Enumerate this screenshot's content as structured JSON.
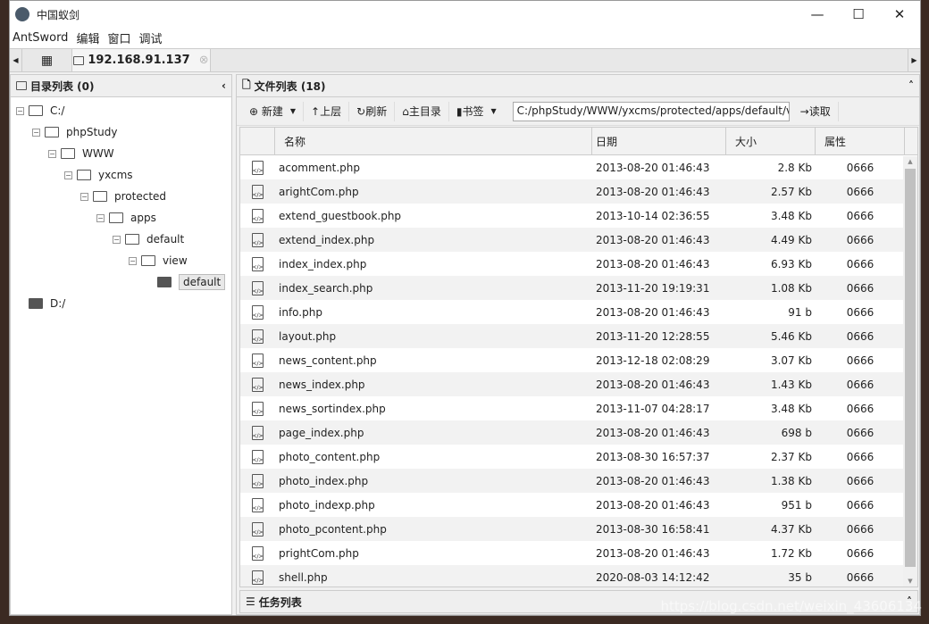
{
  "window": {
    "title": "中国蚁剑",
    "controls": [
      "—",
      "☐",
      "✕"
    ]
  },
  "menu": [
    "AntSword",
    "编辑",
    "窗口",
    "调试"
  ],
  "tabs": {
    "home_icon": "grid-icon",
    "active": "192.168.91.137"
  },
  "dir_panel": {
    "title": "目录列表 (0)",
    "tree": [
      {
        "label": "C:/",
        "depth": 0
      },
      {
        "label": "phpStudy",
        "depth": 1
      },
      {
        "label": "WWW",
        "depth": 2
      },
      {
        "label": "yxcms",
        "depth": 3
      },
      {
        "label": "protected",
        "depth": 4
      },
      {
        "label": "apps",
        "depth": 5
      },
      {
        "label": "default",
        "depth": 6
      },
      {
        "label": "view",
        "depth": 7
      },
      {
        "label": "default",
        "depth": 8,
        "selected": true
      },
      {
        "label": "D:/",
        "depth": 0
      }
    ]
  },
  "file_panel": {
    "title": "文件列表 (18)",
    "toolbar": {
      "new": "新建",
      "up": "上层",
      "refresh": "刷新",
      "home": "主目录",
      "bookmark": "书签",
      "path": "C:/phpStudy/WWW/yxcms/protected/apps/default/view/",
      "read": "读取"
    },
    "columns": [
      "名称",
      "日期",
      "大小",
      "属性"
    ],
    "files": [
      [
        "acomment.php",
        "2013-08-20 01:46:43",
        "2.8 Kb",
        "0666"
      ],
      [
        "arightCom.php",
        "2013-08-20 01:46:43",
        "2.57 Kb",
        "0666"
      ],
      [
        "extend_guestbook.php",
        "2013-10-14 02:36:55",
        "3.48 Kb",
        "0666"
      ],
      [
        "extend_index.php",
        "2013-08-20 01:46:43",
        "4.49 Kb",
        "0666"
      ],
      [
        "index_index.php",
        "2013-08-20 01:46:43",
        "6.93 Kb",
        "0666"
      ],
      [
        "index_search.php",
        "2013-11-20 19:19:31",
        "1.08 Kb",
        "0666"
      ],
      [
        "info.php",
        "2013-08-20 01:46:43",
        "91 b",
        "0666"
      ],
      [
        "layout.php",
        "2013-11-20 12:28:55",
        "5.46 Kb",
        "0666"
      ],
      [
        "news_content.php",
        "2013-12-18 02:08:29",
        "3.07 Kb",
        "0666"
      ],
      [
        "news_index.php",
        "2013-08-20 01:46:43",
        "1.43 Kb",
        "0666"
      ],
      [
        "news_sortindex.php",
        "2013-11-07 04:28:17",
        "3.48 Kb",
        "0666"
      ],
      [
        "page_index.php",
        "2013-08-20 01:46:43",
        "698 b",
        "0666"
      ],
      [
        "photo_content.php",
        "2013-08-30 16:57:37",
        "2.37 Kb",
        "0666"
      ],
      [
        "photo_index.php",
        "2013-08-20 01:46:43",
        "1.38 Kb",
        "0666"
      ],
      [
        "photo_indexp.php",
        "2013-08-20 01:46:43",
        "951 b",
        "0666"
      ],
      [
        "photo_pcontent.php",
        "2013-08-30 16:58:41",
        "4.37 Kb",
        "0666"
      ],
      [
        "prightCom.php",
        "2013-08-20 01:46:43",
        "1.72 Kb",
        "0666"
      ],
      [
        "shell.php",
        "2020-08-03 14:12:42",
        "35 b",
        "0666"
      ]
    ]
  },
  "task_panel": {
    "title": "任务列表"
  },
  "watermark": "https://blog.csdn.net/weixin_43606134"
}
